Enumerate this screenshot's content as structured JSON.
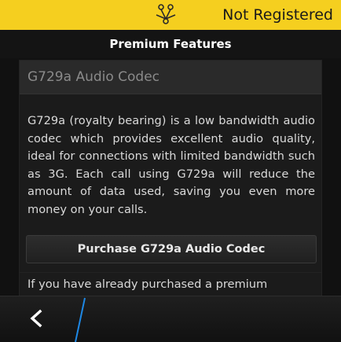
{
  "status": {
    "icon": "connection-nodes-icon",
    "text": "Not Registered",
    "color": "#f5cf1f"
  },
  "header": {
    "title": "Premium Features"
  },
  "feature": {
    "name": "G729a Audio Codec",
    "description": "G729a (royalty bearing) is a low bandwidth audio codec which provides excellent audio quality, ideal for connections with limited bandwidth such as 3G. Each call using G729a will reduce the amount of data used, saving you even more money on your calls.",
    "purchase_label": "Purchase G729a Audio Codec"
  },
  "note": {
    "text": "If you have already purchased a premium"
  },
  "actionbar": {
    "back_icon": "chevron-left-icon",
    "accent": "#1e88e5"
  }
}
